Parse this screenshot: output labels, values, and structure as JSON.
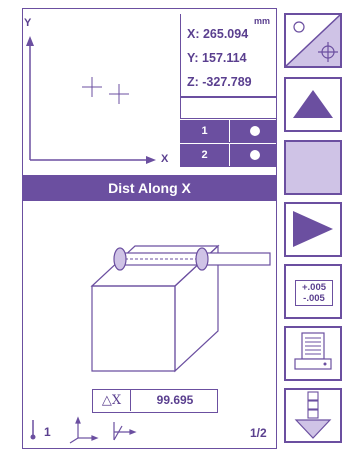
{
  "axes": {
    "y_label": "Y",
    "x_label": "X"
  },
  "coords": {
    "unit": "mm",
    "x": "X:  265.094",
    "y": "Y:  157.114",
    "z": "Z: -327.789"
  },
  "points": [
    {
      "label": "1"
    },
    {
      "label": "2"
    }
  ],
  "measurement": {
    "title": "Dist Along X",
    "delta_label": "△X",
    "value": "99.695"
  },
  "footer": {
    "index": "1",
    "page": "1/2"
  },
  "toolbar": {
    "tolerance_plus": "+.005",
    "tolerance_minus": "-.005"
  },
  "colors": {
    "accent": "#6b4fa0",
    "accent_light": "#cfc3e6"
  },
  "icons": [
    "probe-mode-icon",
    "up-arrow-icon",
    "blank-button",
    "right-arrow-icon",
    "tolerance-icon",
    "printer-icon",
    "scroll-down-icon"
  ]
}
